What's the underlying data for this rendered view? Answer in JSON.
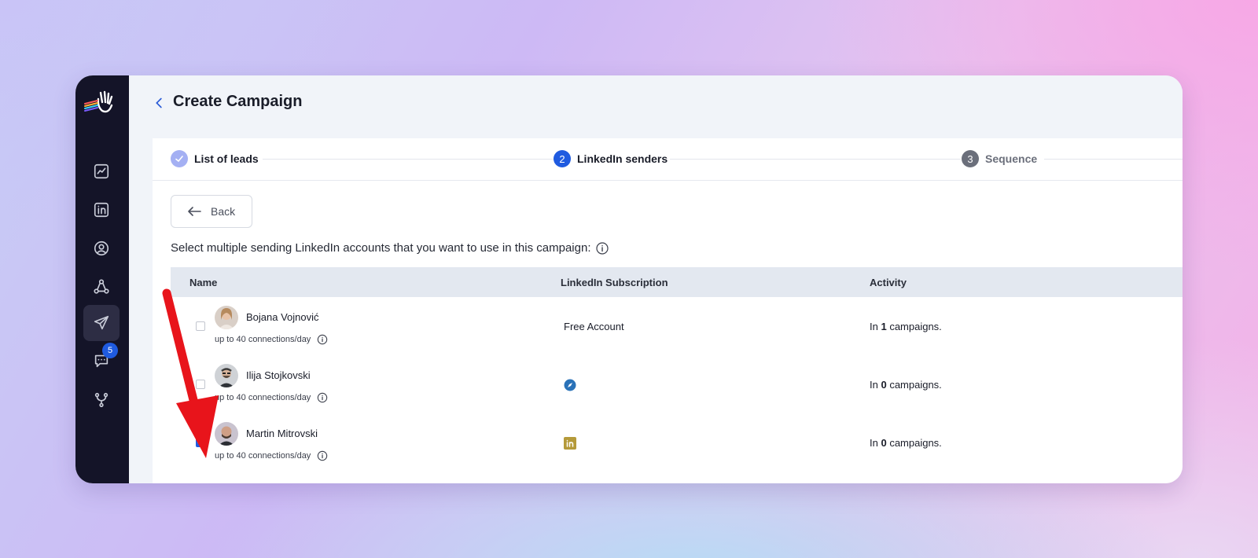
{
  "header": {
    "title": "Create Campaign"
  },
  "sidebar": {
    "items": [
      {
        "icon": "chart-icon"
      },
      {
        "icon": "linkedin-icon"
      },
      {
        "icon": "user-circle-icon"
      },
      {
        "icon": "network-icon"
      },
      {
        "icon": "send-icon",
        "active": true
      },
      {
        "icon": "chat-icon",
        "badge": "5"
      },
      {
        "icon": "integration-icon"
      }
    ]
  },
  "steps": [
    {
      "number": "",
      "label": "List of leads",
      "state": "done"
    },
    {
      "number": "2",
      "label": "LinkedIn senders",
      "state": "current"
    },
    {
      "number": "3",
      "label": "Sequence",
      "state": "upcoming"
    }
  ],
  "back_button": {
    "label": "Back"
  },
  "instruction": "Select multiple sending LinkedIn accounts that you want to use in this campaign:",
  "table": {
    "columns": [
      "Name",
      "LinkedIn Subscription",
      "Activity"
    ],
    "rows": [
      {
        "name": "Bojana Vojnović",
        "limit": "up to 40 connections/day",
        "subscription": "Free Account",
        "subscription_icon": "",
        "activity_prefix": "In ",
        "activity_count": "1",
        "activity_suffix": " campaigns.",
        "checked": false
      },
      {
        "name": "Ilija Stojkovski",
        "limit": "up to 40 connections/day",
        "subscription": "",
        "subscription_icon": "sales-navigator-icon",
        "activity_prefix": "In ",
        "activity_count": "0",
        "activity_suffix": " campaigns.",
        "checked": false
      },
      {
        "name": "Martin Mitrovski",
        "limit": "up to 40 connections/day",
        "subscription": "",
        "subscription_icon": "linkedin-premium-icon",
        "activity_prefix": "In ",
        "activity_count": "0",
        "activity_suffix": " campaigns.",
        "checked": true
      }
    ]
  },
  "colors": {
    "accent": "#1f5be0",
    "sidebar": "#141428",
    "arrow": "#e8141b"
  }
}
